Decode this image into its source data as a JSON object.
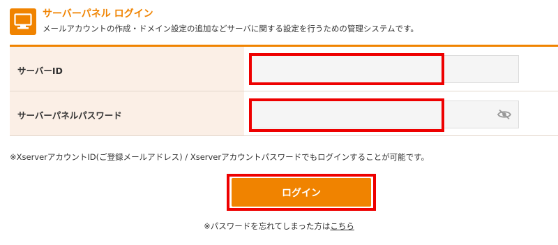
{
  "header": {
    "logo_icon": "monitor-icon",
    "title": "サーバーパネル ログイン",
    "subtitle": "メールアカウントの作成・ドメイン設定の追加などサーバに関する設定を行うための管理システムです。"
  },
  "form": {
    "server_id": {
      "label": "サーバーID",
      "value": "",
      "placeholder": ""
    },
    "password": {
      "label": "サーバーパネルパスワード",
      "value": "",
      "placeholder": "",
      "toggle_icon": "eye-slash-icon"
    }
  },
  "note": "※XserverアカウントID(ご登録メールアドレス) / Xserverアカウントパスワードでもログインすることが可能です。",
  "login_button": "ログイン",
  "forgot": {
    "prefix": "※パスワードを忘れてしまった方は",
    "link": "こちら"
  },
  "colors": {
    "accent": "#f08300",
    "label_bg": "#fbefe6",
    "highlight": "#ee0000"
  }
}
